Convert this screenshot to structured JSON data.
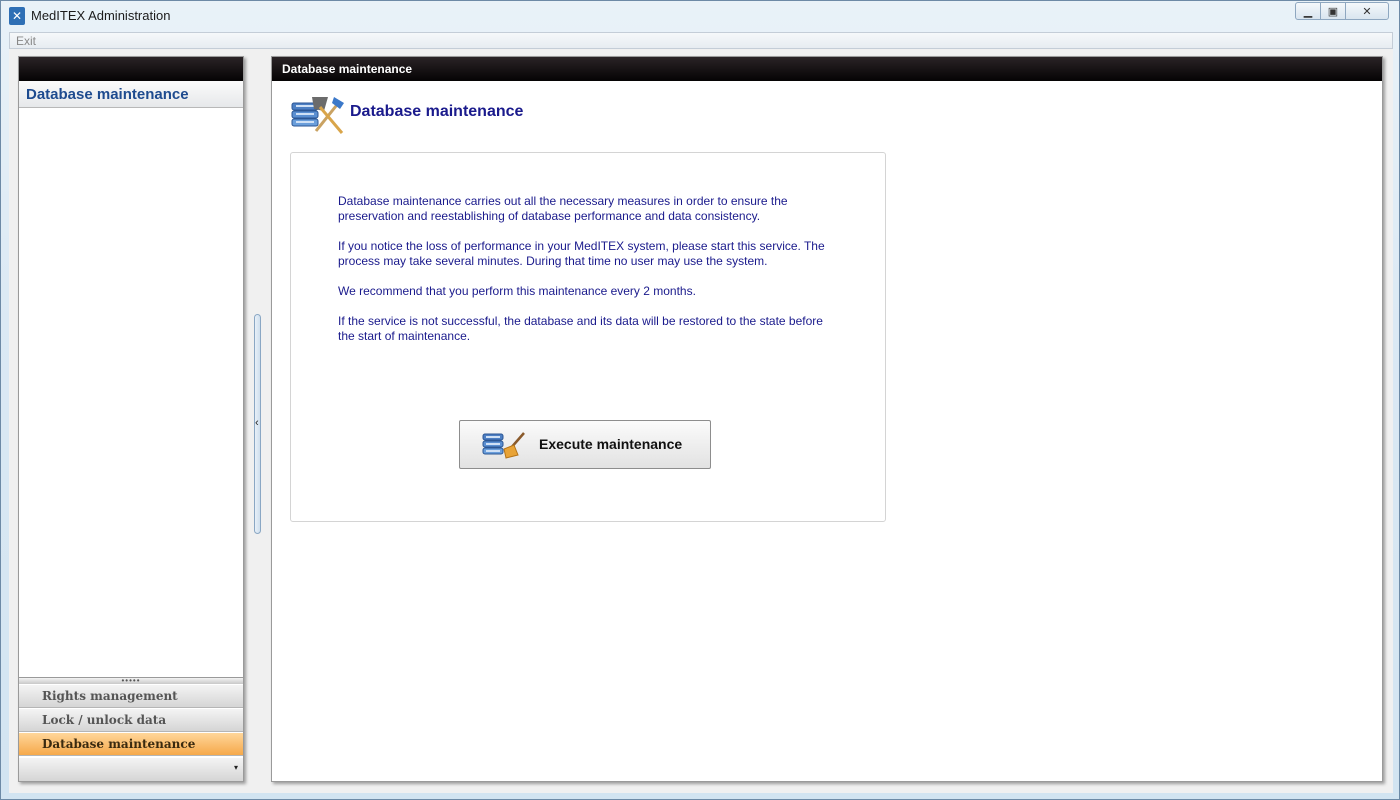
{
  "window": {
    "title": "MedITEX Administration",
    "controls": {
      "minimize": "▁",
      "maximize": "▣",
      "close": "✕"
    }
  },
  "menubar": {
    "exit_label": "Exit"
  },
  "nav": {
    "group_title": "Database maintenance",
    "splitter_grip": "•••••",
    "items": [
      {
        "label": "Rights management",
        "active": false
      },
      {
        "label": "Lock / unlock data",
        "active": false
      },
      {
        "label": "Database maintenance",
        "active": true
      }
    ],
    "overflow_arrow": "▾"
  },
  "collapse_handle": {
    "arrow": "‹"
  },
  "main": {
    "header_title": "Database maintenance",
    "page_title": "Database maintenance",
    "paragraphs": [
      "Database maintenance carries out all the necessary measures in order to ensure the preservation and reestablishing of database performance and data consistency.",
      "If you notice the loss of performance in your MedITEX system, please start this service. The process may take several minutes. During that time no user may use the system.",
      "We recommend that you perform this maintenance every 2 months.",
      "If the service is not successful, the database and its data will be restored to the state before the start of maintenance."
    ],
    "execute_button_label": "Execute maintenance"
  },
  "icons": {
    "app": "wrench-icon",
    "page": "database-broom-icon",
    "button": "database-broom-icon"
  },
  "colors": {
    "accent_text": "#1a1a8c",
    "nav_title": "#1e4b8f",
    "active_item": "#f6a94a",
    "header_bar": "#050304"
  }
}
